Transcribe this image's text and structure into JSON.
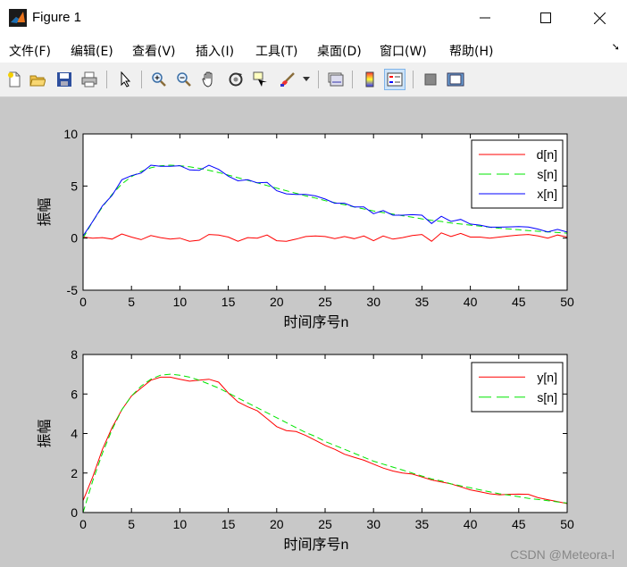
{
  "window": {
    "title": "Figure 1",
    "controls": {
      "minimize": "—",
      "maximize": "☐",
      "close": "✕"
    }
  },
  "menu": [
    {
      "label": "文件(F)"
    },
    {
      "label": "编辑(E)"
    },
    {
      "label": "查看(V)"
    },
    {
      "label": "插入(I)"
    },
    {
      "label": "工具(T)"
    },
    {
      "label": "桌面(D)"
    },
    {
      "label": "窗口(W)"
    },
    {
      "label": "帮助(H)"
    }
  ],
  "toolbar_icons": [
    "new-figure-icon",
    "open-file-icon",
    "save-icon",
    "print-icon",
    "edit-plot-arrow-icon",
    "zoom-in-icon",
    "zoom-out-icon",
    "pan-hand-icon",
    "rotate-3d-icon",
    "data-cursor-icon",
    "brush-icon",
    "dropdown-arrow-icon",
    "link-plot-icon",
    "insert-colorbar-icon",
    "insert-legend-icon",
    "hide-plot-tools-icon",
    "show-plot-tools-icon"
  ],
  "watermark": "CSDN @Meteora-l",
  "colors": {
    "d": "#ff0000",
    "s": "#00e600",
    "x": "#0000ff",
    "y": "#ff0000"
  },
  "chart_data": [
    {
      "type": "line",
      "xlabel": "时间序号n",
      "ylabel": "振幅",
      "xlim": [
        0,
        50
      ],
      "ylim": [
        -5,
        10
      ],
      "xticks": [
        "0",
        "5",
        "10",
        "15",
        "20",
        "25",
        "30",
        "35",
        "40",
        "45",
        "50"
      ],
      "yticks": [
        "-5",
        "0",
        "5",
        "10"
      ],
      "legend_position": "top-right",
      "x": [
        0,
        1,
        2,
        3,
        4,
        5,
        6,
        7,
        8,
        9,
        10,
        11,
        12,
        13,
        14,
        15,
        16,
        17,
        18,
        19,
        20,
        21,
        22,
        23,
        24,
        25,
        26,
        27,
        28,
        29,
        30,
        31,
        32,
        33,
        34,
        35,
        36,
        37,
        38,
        39,
        40,
        41,
        42,
        43,
        44,
        45,
        46,
        47,
        48,
        49,
        50
      ],
      "series": [
        {
          "name": "d[n]",
          "color": "#ff0000",
          "dash": "solid",
          "values": [
            0.1,
            0.0,
            0.05,
            -0.1,
            0.4,
            0.1,
            -0.15,
            0.25,
            0.05,
            -0.1,
            0.0,
            -0.3,
            -0.2,
            0.35,
            0.3,
            0.1,
            -0.3,
            0.05,
            0.0,
            0.3,
            -0.25,
            -0.3,
            -0.1,
            0.15,
            0.2,
            0.15,
            -0.05,
            0.15,
            -0.05,
            0.2,
            -0.25,
            0.2,
            -0.1,
            0.05,
            0.25,
            0.35,
            -0.3,
            0.5,
            0.15,
            0.45,
            0.1,
            0.1,
            0.0,
            0.1,
            0.2,
            0.3,
            0.35,
            0.2,
            0.0,
            0.3,
            0.1
          ]
        },
        {
          "name": "s[n]",
          "color": "#00e600",
          "dash": "dashed",
          "values": [
            0.0,
            1.6,
            3.0,
            4.2,
            5.2,
            5.9,
            6.4,
            6.75,
            6.95,
            7.0,
            6.95,
            6.85,
            6.7,
            6.5,
            6.3,
            6.05,
            5.8,
            5.55,
            5.3,
            5.05,
            4.8,
            4.55,
            4.3,
            4.05,
            3.85,
            3.6,
            3.4,
            3.2,
            3.0,
            2.8,
            2.6,
            2.45,
            2.3,
            2.15,
            2.0,
            1.85,
            1.7,
            1.6,
            1.45,
            1.35,
            1.25,
            1.15,
            1.05,
            0.95,
            0.88,
            0.8,
            0.72,
            0.66,
            0.6,
            0.54,
            0.48
          ]
        },
        {
          "name": "x[n]",
          "color": "#0000ff",
          "dash": "solid",
          "values": [
            0.2,
            1.6,
            3.1,
            4.1,
            5.6,
            6.0,
            6.25,
            7.0,
            6.9,
            6.9,
            6.95,
            6.55,
            6.5,
            7.0,
            6.6,
            5.95,
            5.5,
            5.6,
            5.3,
            5.35,
            4.55,
            4.25,
            4.2,
            4.2,
            4.05,
            3.75,
            3.35,
            3.35,
            3.0,
            3.0,
            2.35,
            2.65,
            2.2,
            2.2,
            2.25,
            2.2,
            1.4,
            2.1,
            1.6,
            1.8,
            1.35,
            1.25,
            1.05,
            1.05,
            1.08,
            1.1,
            1.07,
            0.86,
            0.6,
            0.84,
            0.58
          ]
        }
      ]
    },
    {
      "type": "line",
      "xlabel": "时间序号n",
      "ylabel": "振幅",
      "xlim": [
        0,
        50
      ],
      "ylim": [
        0,
        8
      ],
      "xticks": [
        "0",
        "5",
        "10",
        "15",
        "20",
        "25",
        "30",
        "35",
        "40",
        "45",
        "50"
      ],
      "yticks": [
        "0",
        "2",
        "4",
        "6",
        "8"
      ],
      "legend_position": "top-right",
      "x": [
        0,
        1,
        2,
        3,
        4,
        5,
        6,
        7,
        8,
        9,
        10,
        11,
        12,
        13,
        14,
        15,
        16,
        17,
        18,
        19,
        20,
        21,
        22,
        23,
        24,
        25,
        26,
        27,
        28,
        29,
        30,
        31,
        32,
        33,
        34,
        35,
        36,
        37,
        38,
        39,
        40,
        41,
        42,
        43,
        44,
        45,
        46,
        47,
        48,
        49,
        50
      ],
      "series": [
        {
          "name": "y[n]",
          "color": "#ff0000",
          "dash": "solid",
          "values": [
            0.6,
            1.8,
            3.2,
            4.3,
            5.2,
            5.9,
            6.3,
            6.7,
            6.85,
            6.85,
            6.75,
            6.65,
            6.7,
            6.75,
            6.6,
            6.05,
            5.6,
            5.35,
            5.15,
            4.75,
            4.35,
            4.15,
            4.1,
            3.9,
            3.65,
            3.4,
            3.2,
            2.95,
            2.8,
            2.65,
            2.45,
            2.25,
            2.1,
            2.0,
            1.95,
            1.8,
            1.65,
            1.55,
            1.45,
            1.3,
            1.15,
            1.05,
            0.95,
            0.9,
            0.92,
            0.93,
            0.92,
            0.75,
            0.65,
            0.55,
            0.45
          ]
        },
        {
          "name": "s[n]",
          "color": "#00e600",
          "dash": "dashed",
          "values": [
            0.0,
            1.6,
            3.0,
            4.2,
            5.2,
            5.9,
            6.4,
            6.75,
            6.95,
            7.0,
            6.95,
            6.85,
            6.7,
            6.5,
            6.3,
            6.05,
            5.8,
            5.55,
            5.3,
            5.05,
            4.8,
            4.55,
            4.3,
            4.05,
            3.85,
            3.6,
            3.4,
            3.2,
            3.0,
            2.8,
            2.6,
            2.45,
            2.3,
            2.15,
            2.0,
            1.85,
            1.7,
            1.6,
            1.45,
            1.35,
            1.25,
            1.15,
            1.05,
            0.95,
            0.88,
            0.8,
            0.72,
            0.66,
            0.6,
            0.54,
            0.48
          ]
        }
      ]
    }
  ]
}
